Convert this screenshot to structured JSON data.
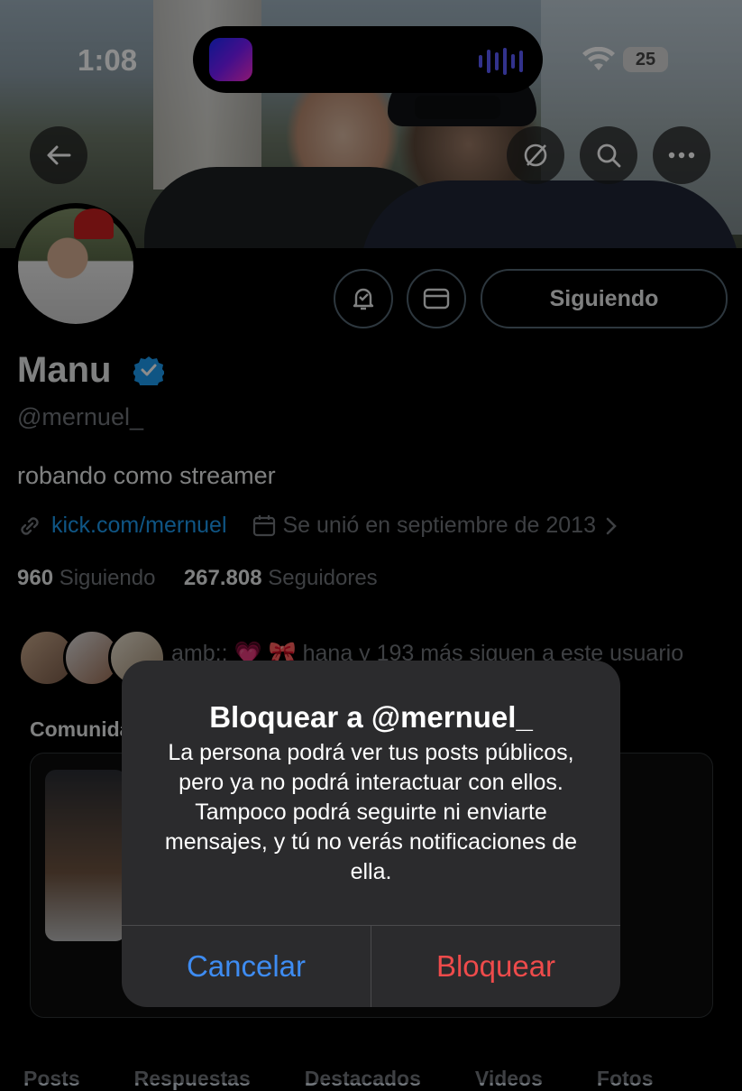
{
  "status_bar": {
    "time": "1:08",
    "battery": "25"
  },
  "profile": {
    "name": "Manu",
    "handle": "@mernuel_",
    "bio": "robando como streamer",
    "link": "kick.com/mernuel",
    "joined": "Se unió en septiembre de 2013",
    "following_count": "960",
    "following_label": "Siguiendo",
    "followers_count": "267.808",
    "followers_label": "Seguidores",
    "follow_button": "Siguiendo",
    "followed_by": "amb:: 💗 🎀 hana y 193 más siguen a este usuario"
  },
  "communities": {
    "label": "Comunidades"
  },
  "tabs": [
    "Posts",
    "Respuestas",
    "Destacados",
    "Videos",
    "Fotos"
  ],
  "alert": {
    "title": "Bloquear a @mernuel_",
    "message": "La persona podrá ver tus posts públicos, pero ya no podrá interactuar con ellos. Tampoco podrá seguirte ni enviarte mensajes, y tú no verás notificaciones de ella.",
    "cancel": "Cancelar",
    "confirm": "Bloquear"
  },
  "colors": {
    "link": "#1d9bf0",
    "alert_cancel": "#3e8cf2",
    "alert_destructive": "#ee4b4b",
    "verified": "#1d9bf0"
  },
  "icons": [
    "back-arrow-icon",
    "grok-icon",
    "search-icon",
    "more-icon",
    "bell-icon",
    "mail-icon",
    "link-icon",
    "calendar-icon",
    "chevron-right-icon",
    "verified-badge-icon"
  ]
}
